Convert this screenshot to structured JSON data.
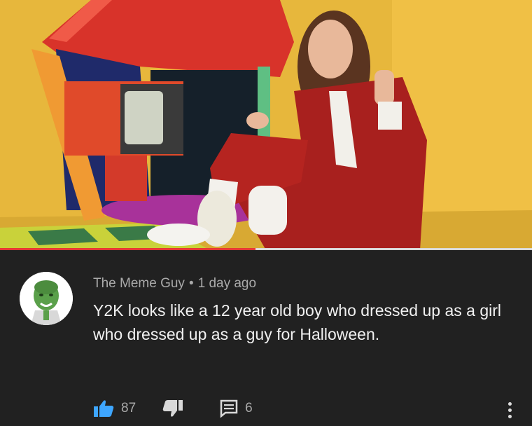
{
  "video": {
    "progress_fraction": 0.48
  },
  "comment": {
    "author": "The Meme Guy",
    "separator": "•",
    "timestamp": "1 day ago",
    "text": "Y2K looks like a 12 year old boy who dressed up as a girl who dressed up as a guy for Halloween.",
    "likes": "87",
    "replies": "6"
  },
  "icons": {
    "like": "thumbs-up-icon",
    "dislike": "thumbs-down-icon",
    "reply": "comment-icon",
    "more": "more-vertical-icon"
  },
  "colors": {
    "background": "#212121",
    "accent_like": "#3ea6ff",
    "progress": "#e53935"
  }
}
